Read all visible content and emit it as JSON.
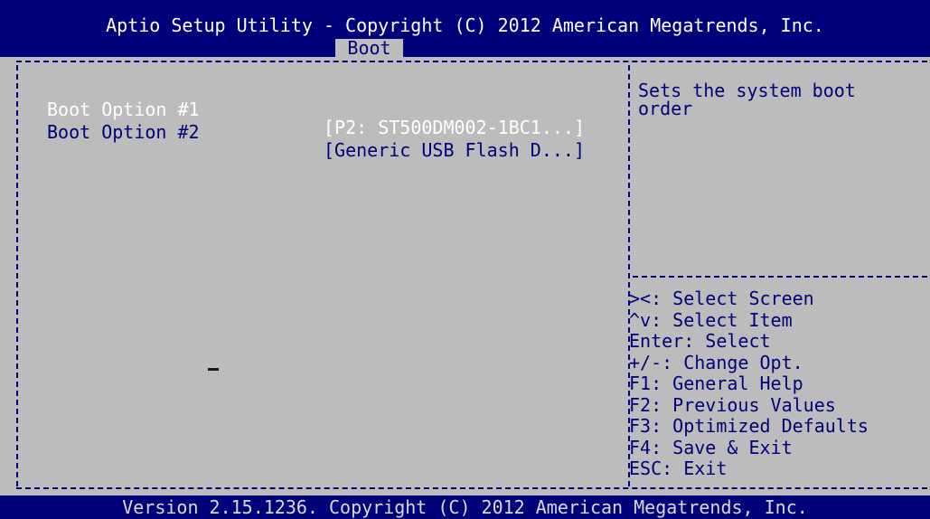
{
  "header": {
    "title": "Aptio Setup Utility - Copyright (C) 2012 American Megatrends, Inc.",
    "tabs": [
      {
        "label": "Boot",
        "active": true
      }
    ]
  },
  "boot_options": [
    {
      "label": "Boot Option #1",
      "value": "[P2: ST500DM002-1BC1...]",
      "selected": true
    },
    {
      "label": "Boot Option #2",
      "value": "[Generic USB Flash D...]",
      "selected": false
    }
  ],
  "help_text": "Sets the system boot order",
  "key_help": [
    "><: Select Screen",
    "^v: Select Item",
    "Enter: Select",
    "+/-: Change Opt.",
    "F1: General Help",
    "F2: Previous Values",
    "F3: Optimized Defaults",
    "F4: Save & Exit",
    "ESC: Exit"
  ],
  "footer": {
    "version": "Version 2.15.1236. Copyright (C) 2012 American Megatrends, Inc."
  },
  "colors": {
    "header_bg": "#00007a",
    "body_bg": "#bcbcbc",
    "text_blue": "#00007a",
    "text_selected": "#ffffff"
  }
}
